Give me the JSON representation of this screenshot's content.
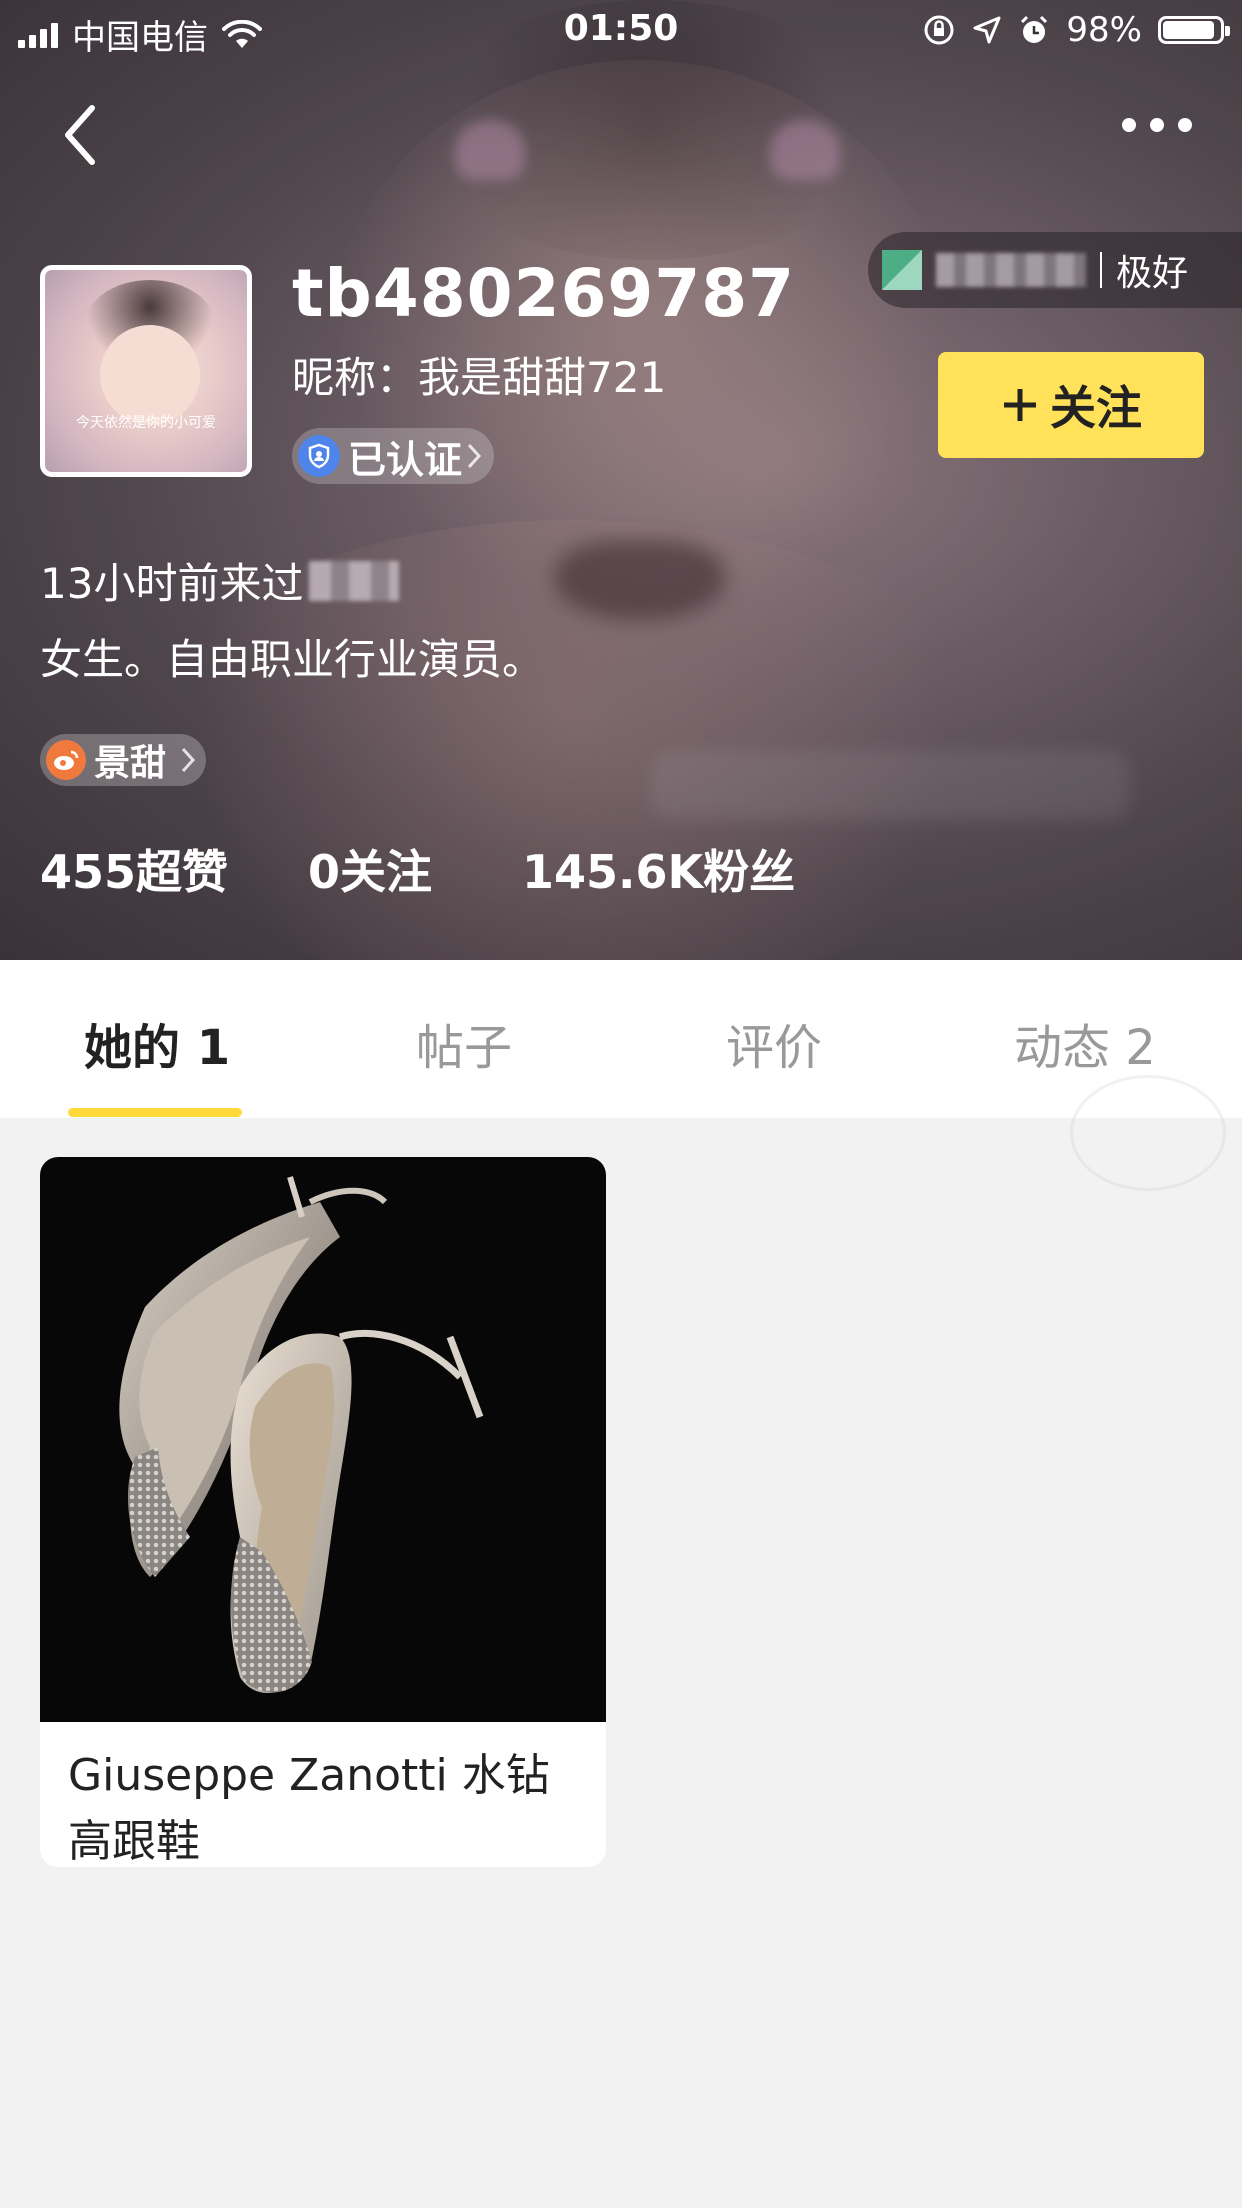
{
  "status_bar": {
    "carrier": "中国电信",
    "time": "01:50",
    "battery_percent": "98%",
    "battery_level": 0.98
  },
  "header": {
    "user_id": "tb480269787",
    "nickname": "昵称：我是甜甜721",
    "verified_label": "已认证",
    "trust_rating": "极好",
    "follow_label": "关注",
    "avatar_caption": "今天依然是你的小可爱",
    "last_seen": "13小时前来过",
    "bio": "女生。自由职业行业演员。",
    "weibo_label": "景甜",
    "stats": {
      "super_likes": "455超赞",
      "following": "0关注",
      "fans": "145.6K粉丝"
    }
  },
  "tabs": [
    {
      "label": "她的 1",
      "active": true
    },
    {
      "label": "帖子",
      "active": false
    },
    {
      "label": "评价",
      "active": false
    },
    {
      "label": "动态 2",
      "active": false
    }
  ],
  "items": [
    {
      "title": "Giuseppe Zanotti 水钻高跟鞋",
      "image": "high-heel-shoes-photo"
    }
  ],
  "colors": {
    "accent_yellow": "#ffe25a",
    "tab_underline": "#ffd93a",
    "verified_blue": "#4f84ea",
    "weibo_orange": "#f07a3e",
    "page_bg": "#f2f2f2"
  }
}
